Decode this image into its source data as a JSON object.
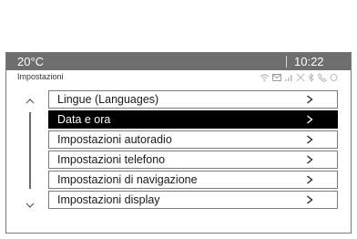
{
  "topbar": {
    "temperature": "20°C",
    "time": "10:22"
  },
  "header": {
    "title": "Impostazioni"
  },
  "status_icons": [
    "wifi-icon",
    "message-icon",
    "signal-icon",
    "phone-off-icon",
    "bluetooth-icon",
    "phone-icon",
    "info-icon"
  ],
  "menu": {
    "items": [
      {
        "label": "Lingue (Languages)",
        "selected": false
      },
      {
        "label": "Data e ora",
        "selected": true
      },
      {
        "label": "Impostazioni autoradio",
        "selected": false
      },
      {
        "label": "Impostazioni telefono",
        "selected": false
      },
      {
        "label": "Impostazioni di navigazione",
        "selected": false
      },
      {
        "label": "Impostazioni display",
        "selected": false
      }
    ]
  },
  "colors": {
    "topbar": "#6e6e6e",
    "selected_row": "#000000",
    "row_border": "#7b7b7b"
  }
}
